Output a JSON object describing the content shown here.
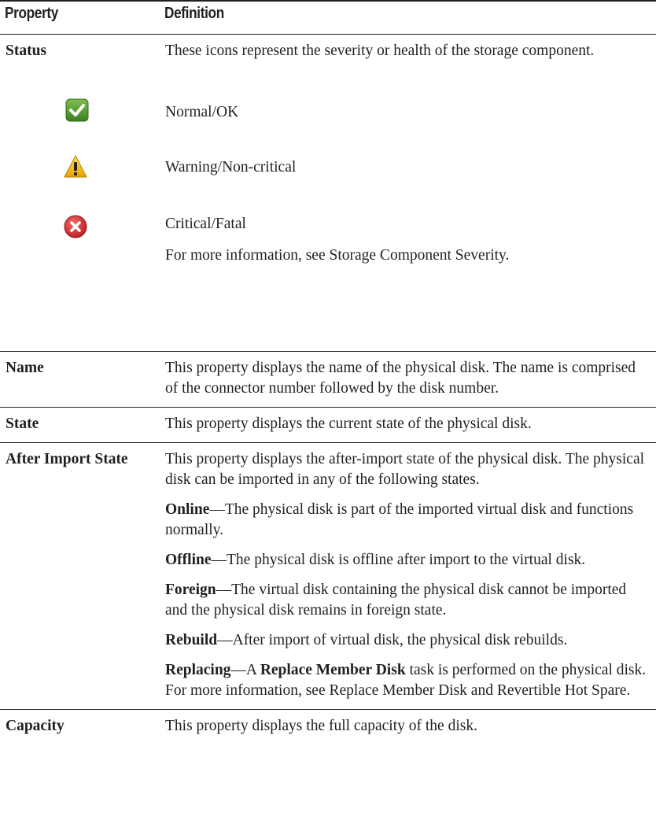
{
  "table": {
    "headers": {
      "property": "Property",
      "definition": "Definition"
    },
    "status": {
      "property": "Status",
      "definition": "These icons represent the severity or health of the storage component.",
      "icons": [
        {
          "icon": "check-icon",
          "label": "Normal/OK",
          "color": "#4e9a2e"
        },
        {
          "icon": "warning-icon",
          "label": "Warning/Non-critical",
          "color": "#f2b400"
        },
        {
          "icon": "critical-icon",
          "label": "Critical/Fatal",
          "color": "#c8272d"
        }
      ],
      "more_info": "For more information, see Storage Component Severity."
    },
    "name": {
      "property": "Name",
      "definition": "This property displays the name of the physical disk. The name is comprised of the connector number followed by the disk number."
    },
    "state": {
      "property": "State",
      "definition": "This property displays the current state of the physical disk."
    },
    "after_import_state": {
      "property": "After Import State",
      "definition": "This property displays the after-import state of the physical disk. The physical disk can be imported in any of the following states.",
      "items": [
        {
          "term": "Online",
          "text": "—The physical disk is part of the imported virtual disk and functions normally."
        },
        {
          "term": "Offline",
          "text": "—The physical disk is offline after import to the virtual disk."
        },
        {
          "term": "Foreign",
          "text": "—The virtual disk containing the physical disk cannot be imported and the physical disk remains in foreign state."
        },
        {
          "term": "Rebuild",
          "text": "—After import of virtual disk, the physical disk rebuilds."
        }
      ],
      "replacing": {
        "term": "Replacing",
        "pre": "—A ",
        "task": "Replace Member Disk",
        "post": " task is performed on the physical disk. For more information, see Replace Member Disk and Revertible Hot Spare."
      }
    },
    "capacity": {
      "property": "Capacity",
      "definition": "This property displays the full capacity of the disk."
    }
  }
}
